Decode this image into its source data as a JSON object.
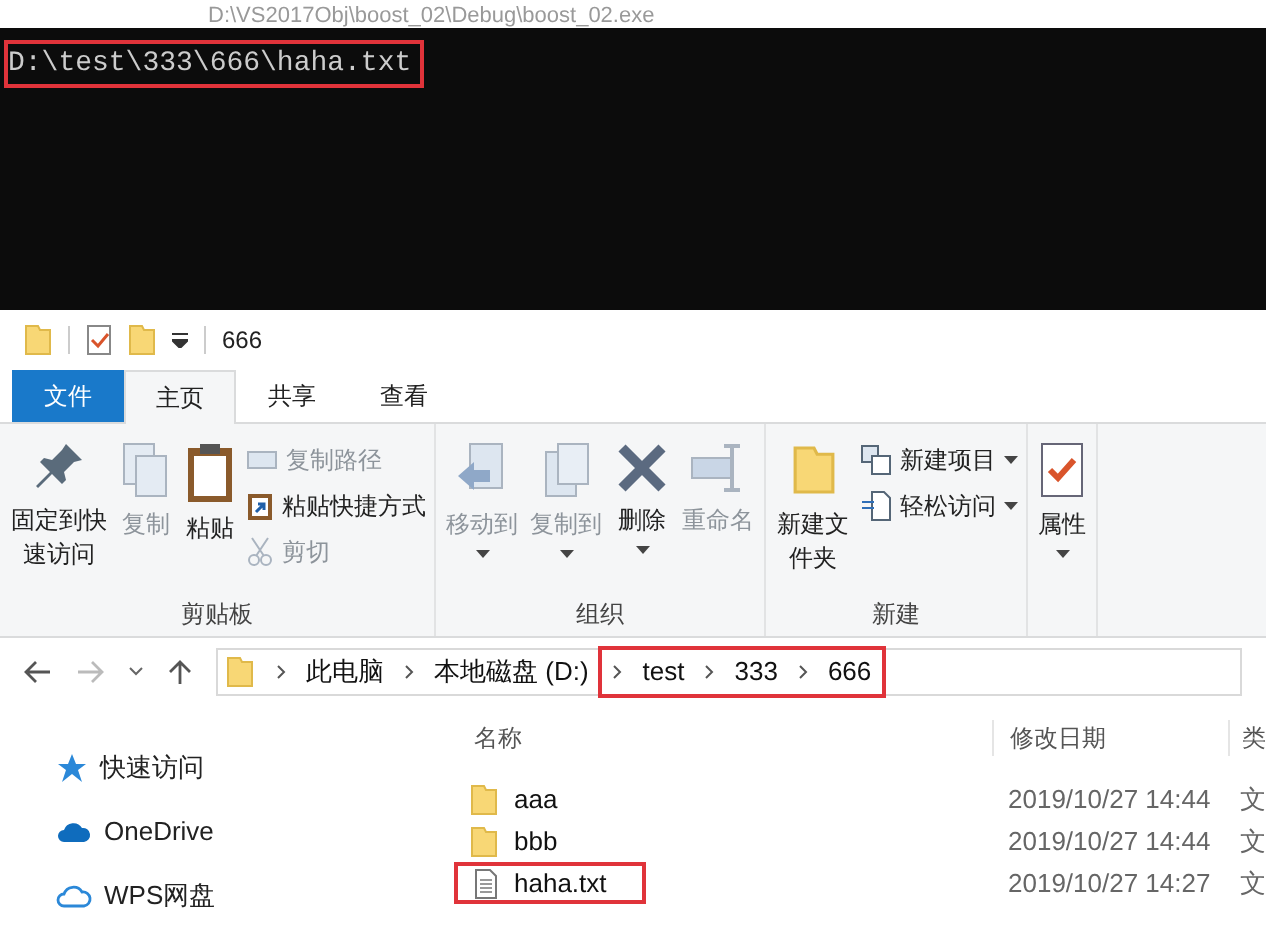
{
  "console": {
    "title": "D:\\VS2017Obj\\boost_02\\Debug\\boost_02.exe",
    "lines": [
      {
        "text": "D:\\test\\333\\666\\haha.txt",
        "highlighted": true
      }
    ]
  },
  "explorer": {
    "title": "666",
    "tabs": [
      {
        "label": "文件",
        "kind": "file",
        "selected": false
      },
      {
        "label": "主页",
        "kind": "tab",
        "selected": true
      },
      {
        "label": "共享",
        "kind": "tab",
        "selected": false
      },
      {
        "label": "查看",
        "kind": "tab",
        "selected": false
      }
    ],
    "ribbon_groups": [
      {
        "label": "剪贴板",
        "items": [
          {
            "kind": "large",
            "label": "固定到快速访问",
            "disabled": false,
            "dropdown": false
          },
          {
            "kind": "large",
            "label": "复制",
            "disabled": true,
            "dropdown": false
          },
          {
            "kind": "large",
            "label": "粘贴",
            "disabled": false,
            "dropdown": false
          },
          {
            "kind": "stack",
            "children": [
              {
                "label": "复制路径",
                "disabled": true,
                "dropdown": false
              },
              {
                "label": "粘贴快捷方式",
                "disabled": false,
                "dropdown": false
              },
              {
                "label": "剪切",
                "disabled": true,
                "dropdown": false
              }
            ]
          }
        ]
      },
      {
        "label": "组织",
        "items": [
          {
            "kind": "large",
            "label": "移动到",
            "disabled": true,
            "dropdown": true
          },
          {
            "kind": "large",
            "label": "复制到",
            "disabled": true,
            "dropdown": true
          },
          {
            "kind": "large",
            "label": "删除",
            "disabled": false,
            "dropdown": true
          },
          {
            "kind": "large",
            "label": "重命名",
            "disabled": true,
            "dropdown": false
          }
        ]
      },
      {
        "label": "新建",
        "items": [
          {
            "kind": "large",
            "label": "新建文件夹",
            "disabled": false,
            "dropdown": false
          },
          {
            "kind": "stack",
            "children": [
              {
                "label": "新建项目",
                "disabled": false,
                "dropdown": true
              },
              {
                "label": "轻松访问",
                "disabled": false,
                "dropdown": true
              }
            ]
          }
        ]
      },
      {
        "items": [
          {
            "kind": "large",
            "label": "属性",
            "disabled": false,
            "dropdown": true
          }
        ]
      }
    ],
    "address": [
      {
        "label": "此电脑",
        "highlighted": false
      },
      {
        "label": "本地磁盘 (D:)",
        "highlighted": false
      },
      {
        "label": "test",
        "highlighted": true
      },
      {
        "label": "333",
        "highlighted": true
      },
      {
        "label": "666",
        "highlighted": true
      }
    ],
    "nav": [
      {
        "label": "快速访问"
      },
      {
        "label": "OneDrive"
      },
      {
        "label": "WPS网盘"
      }
    ],
    "columns": [
      "名称",
      "修改日期",
      "类"
    ],
    "files": [
      {
        "kind": "folder",
        "name": "aaa",
        "date": "2019/10/27 14:44",
        "type": "文",
        "highlighted": false
      },
      {
        "kind": "folder",
        "name": "bbb",
        "date": "2019/10/27 14:44",
        "type": "文",
        "highlighted": false
      },
      {
        "kind": "text",
        "name": "haha.txt",
        "date": "2019/10/27 14:27",
        "type": "文",
        "highlighted": true
      }
    ]
  }
}
